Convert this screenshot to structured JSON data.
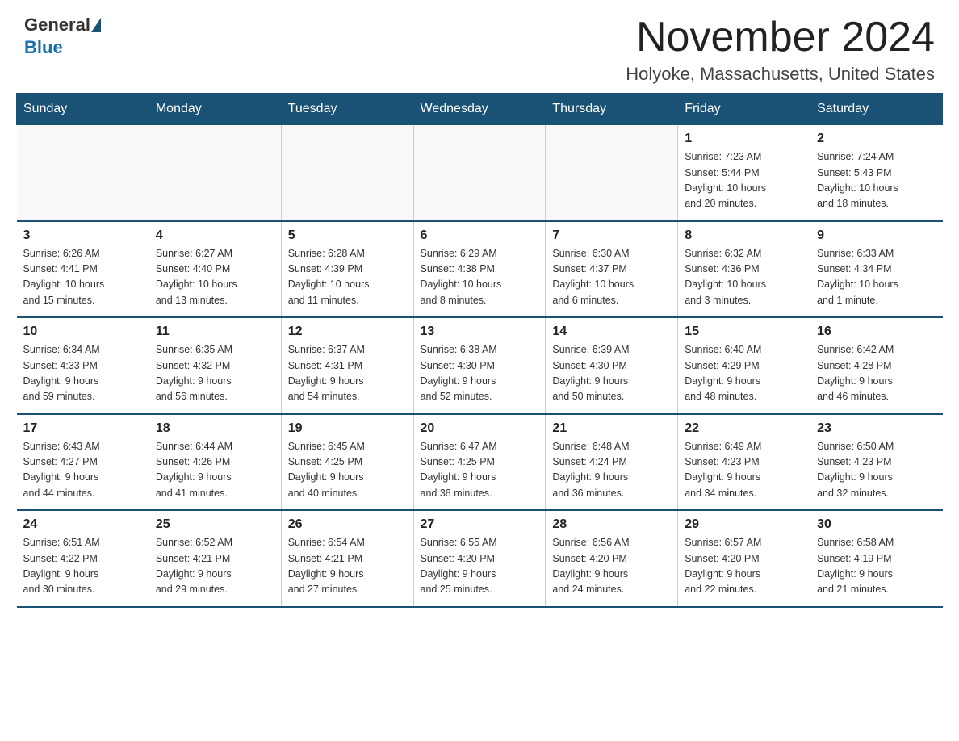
{
  "header": {
    "logo_general": "General",
    "logo_blue": "Blue",
    "month_title": "November 2024",
    "location": "Holyoke, Massachusetts, United States"
  },
  "days_of_week": [
    "Sunday",
    "Monday",
    "Tuesday",
    "Wednesday",
    "Thursday",
    "Friday",
    "Saturday"
  ],
  "weeks": [
    [
      {
        "day": "",
        "info": ""
      },
      {
        "day": "",
        "info": ""
      },
      {
        "day": "",
        "info": ""
      },
      {
        "day": "",
        "info": ""
      },
      {
        "day": "",
        "info": ""
      },
      {
        "day": "1",
        "info": "Sunrise: 7:23 AM\nSunset: 5:44 PM\nDaylight: 10 hours\nand 20 minutes."
      },
      {
        "day": "2",
        "info": "Sunrise: 7:24 AM\nSunset: 5:43 PM\nDaylight: 10 hours\nand 18 minutes."
      }
    ],
    [
      {
        "day": "3",
        "info": "Sunrise: 6:26 AM\nSunset: 4:41 PM\nDaylight: 10 hours\nand 15 minutes."
      },
      {
        "day": "4",
        "info": "Sunrise: 6:27 AM\nSunset: 4:40 PM\nDaylight: 10 hours\nand 13 minutes."
      },
      {
        "day": "5",
        "info": "Sunrise: 6:28 AM\nSunset: 4:39 PM\nDaylight: 10 hours\nand 11 minutes."
      },
      {
        "day": "6",
        "info": "Sunrise: 6:29 AM\nSunset: 4:38 PM\nDaylight: 10 hours\nand 8 minutes."
      },
      {
        "day": "7",
        "info": "Sunrise: 6:30 AM\nSunset: 4:37 PM\nDaylight: 10 hours\nand 6 minutes."
      },
      {
        "day": "8",
        "info": "Sunrise: 6:32 AM\nSunset: 4:36 PM\nDaylight: 10 hours\nand 3 minutes."
      },
      {
        "day": "9",
        "info": "Sunrise: 6:33 AM\nSunset: 4:34 PM\nDaylight: 10 hours\nand 1 minute."
      }
    ],
    [
      {
        "day": "10",
        "info": "Sunrise: 6:34 AM\nSunset: 4:33 PM\nDaylight: 9 hours\nand 59 minutes."
      },
      {
        "day": "11",
        "info": "Sunrise: 6:35 AM\nSunset: 4:32 PM\nDaylight: 9 hours\nand 56 minutes."
      },
      {
        "day": "12",
        "info": "Sunrise: 6:37 AM\nSunset: 4:31 PM\nDaylight: 9 hours\nand 54 minutes."
      },
      {
        "day": "13",
        "info": "Sunrise: 6:38 AM\nSunset: 4:30 PM\nDaylight: 9 hours\nand 52 minutes."
      },
      {
        "day": "14",
        "info": "Sunrise: 6:39 AM\nSunset: 4:30 PM\nDaylight: 9 hours\nand 50 minutes."
      },
      {
        "day": "15",
        "info": "Sunrise: 6:40 AM\nSunset: 4:29 PM\nDaylight: 9 hours\nand 48 minutes."
      },
      {
        "day": "16",
        "info": "Sunrise: 6:42 AM\nSunset: 4:28 PM\nDaylight: 9 hours\nand 46 minutes."
      }
    ],
    [
      {
        "day": "17",
        "info": "Sunrise: 6:43 AM\nSunset: 4:27 PM\nDaylight: 9 hours\nand 44 minutes."
      },
      {
        "day": "18",
        "info": "Sunrise: 6:44 AM\nSunset: 4:26 PM\nDaylight: 9 hours\nand 41 minutes."
      },
      {
        "day": "19",
        "info": "Sunrise: 6:45 AM\nSunset: 4:25 PM\nDaylight: 9 hours\nand 40 minutes."
      },
      {
        "day": "20",
        "info": "Sunrise: 6:47 AM\nSunset: 4:25 PM\nDaylight: 9 hours\nand 38 minutes."
      },
      {
        "day": "21",
        "info": "Sunrise: 6:48 AM\nSunset: 4:24 PM\nDaylight: 9 hours\nand 36 minutes."
      },
      {
        "day": "22",
        "info": "Sunrise: 6:49 AM\nSunset: 4:23 PM\nDaylight: 9 hours\nand 34 minutes."
      },
      {
        "day": "23",
        "info": "Sunrise: 6:50 AM\nSunset: 4:23 PM\nDaylight: 9 hours\nand 32 minutes."
      }
    ],
    [
      {
        "day": "24",
        "info": "Sunrise: 6:51 AM\nSunset: 4:22 PM\nDaylight: 9 hours\nand 30 minutes."
      },
      {
        "day": "25",
        "info": "Sunrise: 6:52 AM\nSunset: 4:21 PM\nDaylight: 9 hours\nand 29 minutes."
      },
      {
        "day": "26",
        "info": "Sunrise: 6:54 AM\nSunset: 4:21 PM\nDaylight: 9 hours\nand 27 minutes."
      },
      {
        "day": "27",
        "info": "Sunrise: 6:55 AM\nSunset: 4:20 PM\nDaylight: 9 hours\nand 25 minutes."
      },
      {
        "day": "28",
        "info": "Sunrise: 6:56 AM\nSunset: 4:20 PM\nDaylight: 9 hours\nand 24 minutes."
      },
      {
        "day": "29",
        "info": "Sunrise: 6:57 AM\nSunset: 4:20 PM\nDaylight: 9 hours\nand 22 minutes."
      },
      {
        "day": "30",
        "info": "Sunrise: 6:58 AM\nSunset: 4:19 PM\nDaylight: 9 hours\nand 21 minutes."
      }
    ]
  ]
}
